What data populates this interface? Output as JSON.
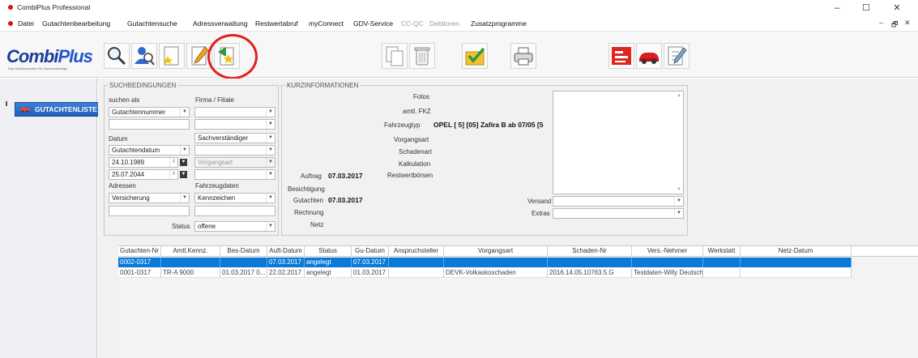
{
  "window": {
    "title": "CombiPlus Professional",
    "minimize": "–",
    "maximize": "☐",
    "close": "✕"
  },
  "menu": {
    "items": [
      {
        "label": "Datei",
        "enabled": true
      },
      {
        "label": "Gutachtenbearbeitung",
        "enabled": true
      },
      {
        "label": "Gutachtensuche",
        "enabled": true
      },
      {
        "label": "Adressverwaltung",
        "enabled": true
      },
      {
        "label": "Restwertabruf",
        "enabled": true
      },
      {
        "label": "myConnect",
        "enabled": true
      },
      {
        "label": "GDV-Service",
        "enabled": true
      },
      {
        "label": "CC-QC",
        "enabled": false
      },
      {
        "label": "Debitoren",
        "enabled": false
      },
      {
        "label": "Zusatzprogramme",
        "enabled": true
      }
    ],
    "mdi_minimize": "–",
    "mdi_restore": "🗗",
    "mdi_close": "✕"
  },
  "logo": {
    "text_combi": "Combi",
    "text_plus": "Plus",
    "slogan": "Das Softwaresystem für Sachverständige"
  },
  "toolbar": {
    "icons": [
      "search-icon",
      "user-search-icon",
      "new-document-star-icon",
      "edit-pencil-icon",
      "new-report-star-icon",
      "copy-documents-icon",
      "trash-icon",
      "check-folder-icon",
      "printer-icon",
      "red-form-icon",
      "red-car-icon",
      "checklist-pencil-icon"
    ]
  },
  "sidebar": {
    "gutachtenliste_label": "GUTACHTENLISTE"
  },
  "search": {
    "legend": "SUCHBEDINGUNGEN",
    "suchen_als_label": "suchen als",
    "suchen_als_value": "Gutachtennummer",
    "firma_label": "Firma / Filiale",
    "firma_value": "",
    "filiale_value": "",
    "search_text_value": "",
    "datum_label": "Datum",
    "datum_type_value": "Gutachtendatum",
    "date_from": "24.10.1989",
    "date_to": "25.07.2044",
    "sachverstaendiger_label": "Sachverständiger",
    "sachverstaendiger_value": "Sachverständiger",
    "sv_value": "",
    "vorgangsart_value": "Vorgangsart",
    "vorgangsart2_value": "",
    "adressen_label": "Adressen",
    "adressen_value": "Versicherung",
    "adressen_text": "",
    "fahrzeugdaten_label": "Fahrzeugdaten",
    "fahrzeugdaten_value": "Kennzeichen",
    "fahrzeugdaten_text": "",
    "status_label": "Status",
    "status_value": "offene"
  },
  "info": {
    "legend": "KURZINFORMATIONEN",
    "fotos_label": "Fotos",
    "amtl_fkz_label": "amtl. FKZ",
    "fahrzeugtyp_label": "Fahrzeugtyp",
    "fahrzeugtyp_value": "OPEL [ 5] [05] Zafira B ab 07/05 [5",
    "vorgangsart_label": "Vorgangsart",
    "schadenart_label": "Schadenart",
    "kalkulation_label": "Kalkulation",
    "auftrag_label": "Auftrag",
    "auftrag_value": "07.03.2017",
    "restwertboersen_label": "Restwertbörsen",
    "besichtigung_label": "Besichtigung",
    "gutachten_label": "Gutachten",
    "gutachten_value": "07.03.2017",
    "rechnung_label": "Rechnung",
    "netz_label": "Netz",
    "versand_label": "Versand",
    "versand_value": "",
    "extras_label": "Extras",
    "extras_value": ""
  },
  "table": {
    "columns": [
      "Gutachten-Nr",
      "Amtl.Kennz.",
      "Bes-Datum",
      "Auft-Datum",
      "Status",
      "Gu-Datum",
      "Anspruchsteller",
      "Vorgangsart",
      "Schaden-Nr",
      "Vers.-Nehmer",
      "Werkstatt",
      "Netz-Datum"
    ],
    "rows": [
      [
        "0002-0317",
        "",
        "",
        "07.03.2017",
        "angelegt",
        "07.03.2017",
        "",
        "",
        "",
        "",
        "",
        ""
      ],
      [
        "0001-0317",
        "TR-A 9000",
        "01.03.2017 0...",
        "22.02.2017",
        "angelegt",
        "01.03.2017",
        "",
        "DEVK-Volkaskoschaden",
        "2016.14.05.10763.5.G",
        "Testdaten-Willy Deutsch",
        "",
        ""
      ]
    ]
  }
}
